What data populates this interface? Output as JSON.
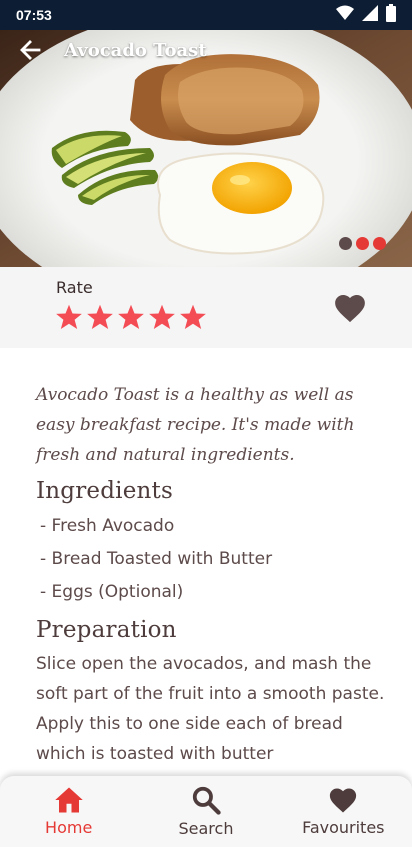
{
  "status_bar": {
    "time": "07:53"
  },
  "app_bar": {
    "title": "Avocado Toast"
  },
  "gallery": {
    "current_index": 0,
    "count": 3,
    "active_color": "#e53935",
    "inactive_color": "#5d4a4a"
  },
  "rating": {
    "label": "Rate",
    "value": 5,
    "max": 5,
    "star_color": "#f44c54"
  },
  "favourite": {
    "active": false,
    "color": "#5d4a4a"
  },
  "recipe": {
    "intro": "Avocado Toast is a healthy as well as easy breakfast recipe. It's made with fresh and natural ingredients.",
    "ingredients_title": "Ingredients",
    "ingredients": [
      " - Fresh Avocado",
      " - Bread Toasted with Butter",
      " - Eggs (Optional)"
    ],
    "preparation_title": "Preparation",
    "preparation": "Slice open the avocados, and mash the soft part of the fruit into a smooth paste. Apply this to one side each of bread which is toasted with butter"
  },
  "bottom_nav": {
    "active_color": "#e53935",
    "inactive_color": "#4e3c3c",
    "items": [
      {
        "label": "Home",
        "icon": "home-icon",
        "active": true
      },
      {
        "label": "Search",
        "icon": "search-icon",
        "active": false
      },
      {
        "label": "Favourites",
        "icon": "heart-icon",
        "active": false
      }
    ]
  }
}
